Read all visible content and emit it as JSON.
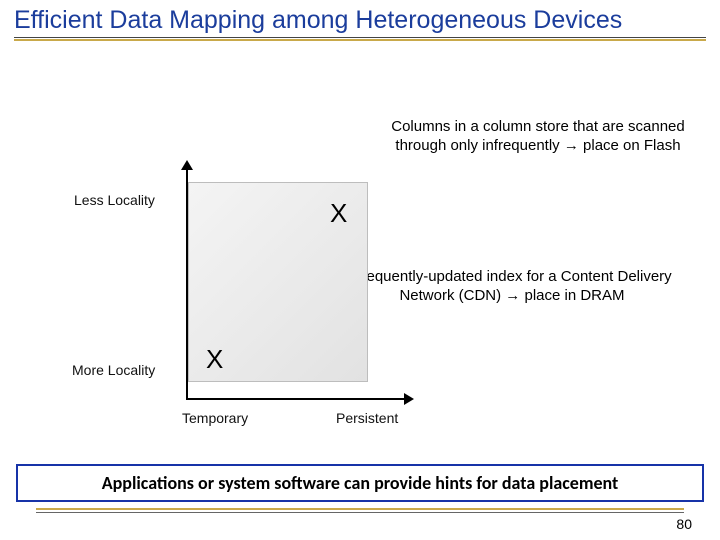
{
  "title": "Efficient Data Mapping among Heterogeneous Devices",
  "axes": {
    "y_top": "Less Locality",
    "y_bottom": "More Locality",
    "x_left": "Temporary",
    "x_right": "Persistent"
  },
  "marks": {
    "x1": "X",
    "x2": "X"
  },
  "annotations": {
    "top": "Columns in a column store that are scanned through only infrequently → place on Flash",
    "middle": "Frequently-updated index for a Content Delivery Network (CDN) → place in DRAM"
  },
  "callout": "Applications or system software can provide hints for data placement",
  "page": "80"
}
